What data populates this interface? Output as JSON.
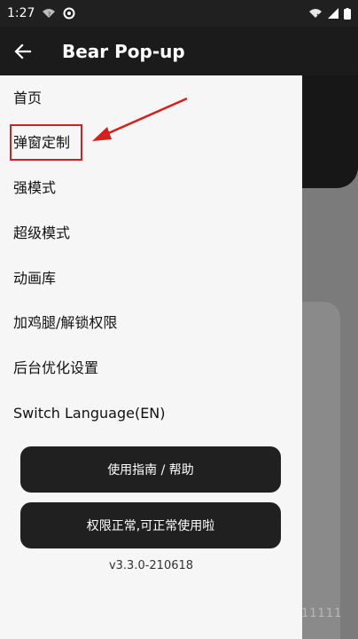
{
  "status_bar": {
    "time": "1:27"
  },
  "app_bar": {
    "title": "Bear Pop-up"
  },
  "menu": {
    "items": [
      {
        "label": "首页"
      },
      {
        "label": "弹窗定制"
      },
      {
        "label": "强模式"
      },
      {
        "label": "超级模式"
      },
      {
        "label": "动画库"
      },
      {
        "label": "加鸡腿/解锁权限"
      },
      {
        "label": "后台优化设置"
      },
      {
        "label": "Switch Language(EN)"
      }
    ]
  },
  "buttons": {
    "guide_label": "使用指南 / 帮助",
    "permission_label": "权限正常,可正常使用啦"
  },
  "version": "v3.3.0-210618",
  "background": {
    "digits": "11111"
  },
  "colors": {
    "annotation_red": "#d61f1f",
    "drawer_bg": "#f6f6f6",
    "button_bg": "#202020"
  }
}
